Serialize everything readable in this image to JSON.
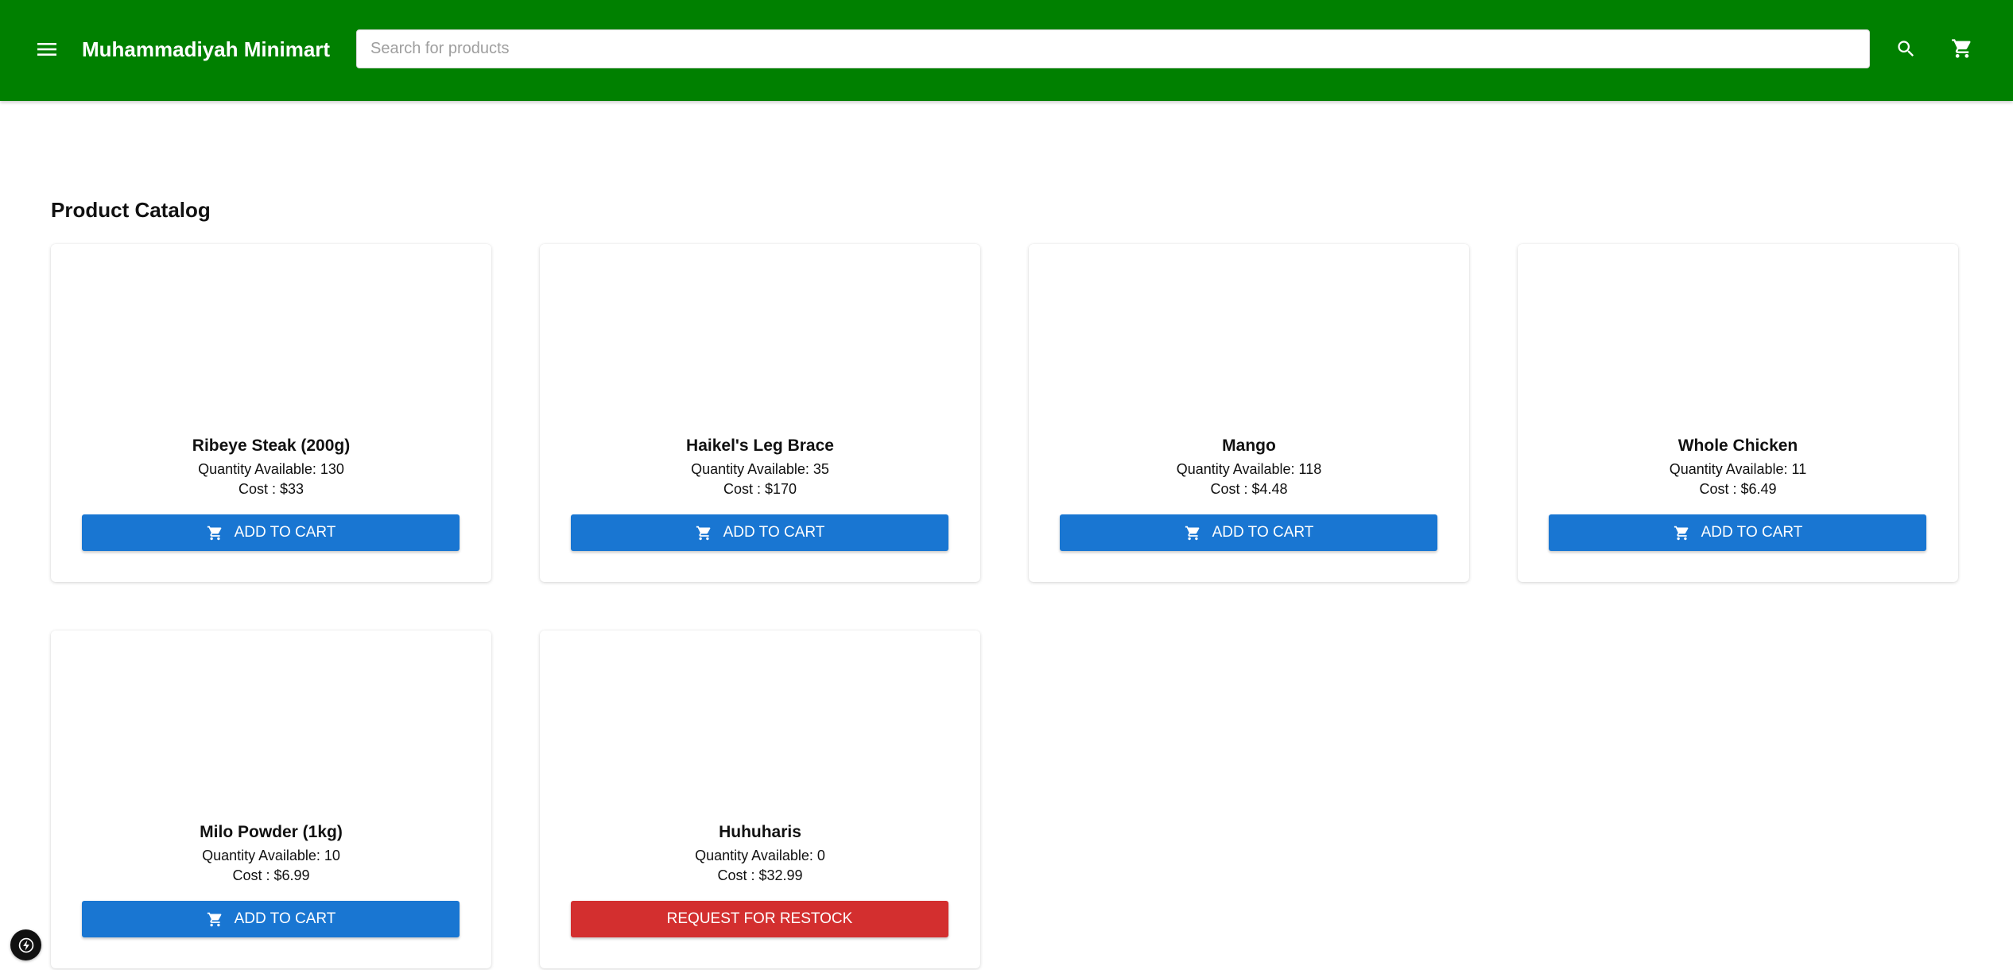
{
  "header": {
    "brand": "Muhammadiyah Minimart",
    "search_placeholder": "Search for products",
    "menu_icon": "menu-icon",
    "search_icon": "search-icon",
    "cart_icon": "cart-icon",
    "background_color": "#008000"
  },
  "main": {
    "title": "Product Catalog",
    "products": [
      {
        "name": "Ribeye Steak (200g)",
        "quantity": "Quantity Available: 130",
        "cost": "Cost : $33",
        "action": "ADD TO CART"
      },
      {
        "name": "Haikel's Leg Brace",
        "quantity": "Quantity Available: 35",
        "cost": "Cost : $170",
        "action": "ADD TO CART"
      },
      {
        "name": "Mango",
        "quantity": "Quantity Available: 118",
        "cost": "Cost : $4.48",
        "action": "ADD TO CART"
      },
      {
        "name": "Whole Chicken",
        "quantity": "Quantity Available: 11",
        "cost": "Cost : $6.49",
        "action": "ADD TO CART"
      },
      {
        "name": "Milo Powder (1kg)",
        "quantity": "Quantity Available: 10",
        "cost": "Cost : $6.99",
        "action": "ADD TO CART"
      },
      {
        "name": "Huhuharis",
        "quantity": "Quantity Available: 0",
        "cost": "Cost : $32.99",
        "action": "REQUEST FOR RESTOCK"
      }
    ]
  },
  "colors": {
    "add_to_cart": "#1976d2",
    "restock": "#d32f2f",
    "text": "#111111"
  },
  "floating_icon": "lightning-icon"
}
